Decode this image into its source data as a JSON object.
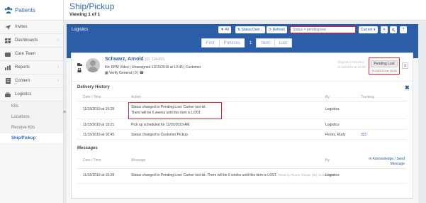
{
  "brand": {
    "name": "Patients"
  },
  "sidebar": {
    "items": [
      {
        "label": "Invites",
        "icon": "send-icon",
        "chevron": false
      },
      {
        "label": "Dashboards",
        "icon": "dashboard-icon",
        "chevron": true
      },
      {
        "label": "Care Team",
        "icon": "care-team-icon",
        "chevron": false
      },
      {
        "label": "Reports",
        "icon": "bar-chart-icon",
        "chevron": true
      },
      {
        "label": "Content",
        "icon": "document-icon",
        "chevron": true
      },
      {
        "label": "Logistics",
        "icon": "briefcase-icon",
        "chevron": false
      }
    ],
    "subitems": [
      "Kits",
      "Locations",
      "Receive Kits",
      "Ship/Pickup"
    ],
    "active_subitem": "Ship/Pickup"
  },
  "header": {
    "title": "Ship/Pickup",
    "subtitle": "Viewing 1 of 1"
  },
  "toolbar": {
    "section": "Logistics",
    "all_label": "All",
    "status_date_label": "Status Date",
    "refresh_label": "Refresh",
    "search_value": "Status = pending lost",
    "current_label": "Current"
  },
  "pager": {
    "first": "First",
    "previous": "Previous",
    "page": "1",
    "next": "Next",
    "last": "Last"
  },
  "patient": {
    "name": "Schwarz, Arnold",
    "id": "(ID: 104400)",
    "kit_line": "Kit: RPM Video | Unassigned 11/15/2019 at 10:45 | Customer",
    "program_line": "Verify General | 0 |",
    "ghost_status": "Shipment Pending",
    "ghost_date": "11/15/2019 at 15:20",
    "status": "Pending Lost",
    "status_date": "11/15/2019 at 15:28"
  },
  "delivery": {
    "title": "Delivery History",
    "headers": {
      "date": "Date / Time",
      "action": "Action",
      "by": "By",
      "tracking": "Tracking"
    },
    "rows": [
      {
        "date": "11/15/2019 at 15:28",
        "action1": "Status changed to Pending Lost: Carrier lost kit.",
        "action2": "There will be 6 weeks until this item is LOST.",
        "by": "Logistics",
        "tracking": ""
      },
      {
        "date": "11/15/2019 at 15:21",
        "action1": "Pick up scheduled for 11/20/2019 AM.",
        "action2": "",
        "by": "Logistics",
        "tracking": ""
      },
      {
        "date": "11/15/2019 at 10:45",
        "action1": "Status changed to Customer Pickup",
        "action2": "",
        "by": "Flores, Rudy",
        "tracking": "321"
      }
    ]
  },
  "messages": {
    "title": "Messages",
    "headers": {
      "date": "Date / Time",
      "message": "Message",
      "by": "By",
      "ack": "Acknowledge / Send Message"
    },
    "rows": [
      {
        "date": "11/15/2019 at 15:28",
        "message": "Status changed to Pending Lost: Carrier lost kit. There will be 6 weeks until this item is LOST.",
        "read_by": "Read by Flores, Roque (ID) 11/15/2019",
        "by": "Logistics"
      }
    ]
  }
}
